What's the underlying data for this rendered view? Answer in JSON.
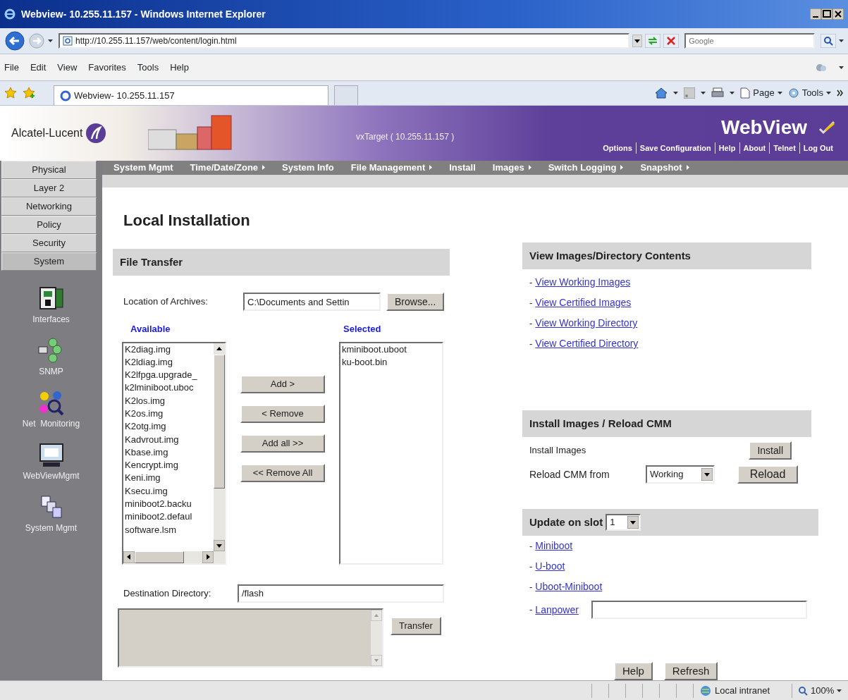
{
  "browser": {
    "title": "Webview- 10.255.11.157 - Windows Internet Explorer",
    "address": "http://10.255.11.157/web/content/login.html",
    "search_placeholder": "Google",
    "menu": [
      "File",
      "Edit",
      "View",
      "Favorites",
      "Tools",
      "Help"
    ],
    "tab": "Webview- 10.255.11.157",
    "commands": [
      {
        "label": "Page",
        "kind": "page"
      },
      {
        "label": "Tools",
        "kind": "tools"
      }
    ],
    "status": {
      "zone": "Local intranet",
      "zoom": "100%"
    }
  },
  "header": {
    "brand": "Alcatel-Lucent",
    "target": "vxTarget ( 10.255.11.157 )",
    "app": "WebView",
    "links": [
      "Options",
      "Save Configuration",
      "Help",
      "About",
      "Telnet",
      "Log Out"
    ]
  },
  "sidebar": {
    "tabs": [
      {
        "label": "Physical",
        "selected": false
      },
      {
        "label": "Layer 2",
        "selected": false
      },
      {
        "label": "Networking",
        "selected": false
      },
      {
        "label": "Policy",
        "selected": false
      },
      {
        "label": "Security",
        "selected": false
      },
      {
        "label": "System",
        "selected": true
      }
    ],
    "items": [
      {
        "label": "Interfaces",
        "kind": "interfaces"
      },
      {
        "label": "SNMP",
        "kind": "snmp"
      },
      {
        "label": "Net  Monitoring",
        "kind": "monitoring"
      },
      {
        "label": "WebViewMgmt",
        "kind": "webview"
      },
      {
        "label": "System Mgmt",
        "kind": "system"
      }
    ]
  },
  "nav": [
    {
      "label": "System Mgmt",
      "submenu": false
    },
    {
      "label": "Time/Date/Zone",
      "submenu": true
    },
    {
      "label": "System Info",
      "submenu": false
    },
    {
      "label": "File Management",
      "submenu": true
    },
    {
      "label": "Install",
      "submenu": false
    },
    {
      "label": "Images",
      "submenu": true
    },
    {
      "label": "Switch Logging",
      "submenu": true
    },
    {
      "label": "Snapshot",
      "submenu": true
    }
  ],
  "page": {
    "title": "Local Installation",
    "file_transfer": {
      "heading": "File Transfer",
      "archive_label": "Location of Archives:",
      "archive_value": "C:\\Documents and Settin",
      "browse": "Browse...",
      "available_label": "Available",
      "available": [
        "K2diag.img",
        "K2ldiag.img",
        "K2lfpga.upgrade_",
        "k2lminiboot.uboc",
        "K2los.img",
        "K2os.img",
        "K2otg.img",
        "Kadvrout.img",
        "Kbase.img",
        "Kencrypt.img",
        "Keni.img",
        "Ksecu.img",
        "miniboot2.backu",
        "miniboot2.defaul",
        "software.lsm"
      ],
      "actions": [
        "Add >",
        "< Remove",
        "Add all >>",
        "<< Remove All"
      ],
      "selected_label": "Selected",
      "selected": [
        "kminiboot.uboot",
        "ku-boot.bin"
      ],
      "dest_label": "Destination Directory:",
      "dest_value": "/flash",
      "transfer": "Transfer"
    },
    "view": {
      "heading": "View Images/Directory Contents",
      "links": [
        {
          "prefix": "-",
          "label": "View Working Images"
        },
        {
          "prefix": "-",
          "label": "View Certified Images"
        },
        {
          "prefix": "-",
          "label": "View Working Directory"
        },
        {
          "prefix": "-",
          "label": "View Certified Directory"
        }
      ]
    },
    "install": {
      "heading": "Install Images / Reload CMM",
      "install_label": "Install Images",
      "install_button": "Install",
      "reload_label": "Reload CMM from",
      "reload_value": "Working",
      "reload_button": "Reload"
    },
    "update": {
      "heading": "Update on slot",
      "slot": "1",
      "links": [
        {
          "prefix": "-",
          "label": "Miniboot",
          "kind": "link"
        },
        {
          "prefix": "-",
          "label": "U-boot",
          "kind": "link"
        },
        {
          "prefix": "-",
          "label": "Uboot-Miniboot",
          "kind": "link"
        },
        {
          "prefix": "-",
          "label": "Lanpower",
          "kind": "field"
        }
      ]
    },
    "buttons": [
      "Help",
      "Refresh"
    ]
  }
}
